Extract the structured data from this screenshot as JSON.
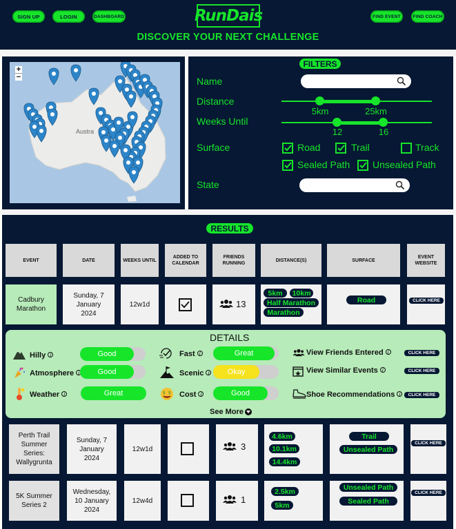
{
  "header": {
    "nav_left": [
      "SIGN UP",
      "LOGIN",
      "DASHBOARD"
    ],
    "logo": "RunDais",
    "nav_right": [
      "FIND EVENT",
      "FIND COACH"
    ],
    "tagline": "DISCOVER YOUR NEXT CHALLENGE"
  },
  "map": {
    "zoom_in": "+",
    "zoom_out": "−",
    "label": "Austra"
  },
  "filters": {
    "title": "FILTERS",
    "name_label": "Name",
    "distance_label": "Distance",
    "distance_min": "5km",
    "distance_max": "25km",
    "weeks_label": "Weeks Until",
    "weeks_min": "12",
    "weeks_max": "16",
    "surface_label": "Surface",
    "surfaces": [
      {
        "label": "Road",
        "checked": true
      },
      {
        "label": "Trail",
        "checked": true
      },
      {
        "label": "Track",
        "checked": false
      },
      {
        "label": "Sealed Path",
        "checked": true
      },
      {
        "label": "Unsealed Path",
        "checked": true
      }
    ],
    "state_label": "State"
  },
  "results": {
    "title": "RESULTS",
    "columns": [
      "EVENT",
      "DATE",
      "WEEKS UNTIL",
      "ADDED TO CALENDAR",
      "FRIENDS RUNNING",
      "DISTANCE(S)",
      "SURFACE",
      "EVENT WEBSITE"
    ],
    "rows": [
      {
        "event": "Cadbury Marathon",
        "date": "Sunday, 7 January 2024",
        "weeks": "12w1d",
        "added": true,
        "friends": "13",
        "distances": [
          "5km",
          "10km",
          "Half Marathon",
          "Marathon"
        ],
        "surfaces": [
          "Road"
        ],
        "website": "CLICK HERE"
      },
      {
        "event": "Perth Trail Summer Series: Wallygrunta",
        "date": "Sunday, 7 January 2024",
        "weeks": "12w1d",
        "added": false,
        "friends": "3",
        "distances": [
          "4.6km",
          "10.1km",
          "14.4km"
        ],
        "surfaces": [
          "Trail",
          "Unsealed Path"
        ],
        "website": "CLICK HERE"
      },
      {
        "event": "5K Summer Series 2",
        "date": "Wednesday, 10 January 2024",
        "weeks": "12w4d",
        "added": false,
        "friends": "1",
        "distances": [
          "2.5km",
          "5km"
        ],
        "surfaces": [
          "Unsealed Path",
          "Sealed Path"
        ],
        "website": "CLICK HERE"
      }
    ]
  },
  "details": {
    "title": "DETAILS",
    "ratings": [
      {
        "label": "Hilly",
        "value": "Good",
        "level": 0.82,
        "icon": "mountain-icon"
      },
      {
        "label": "Atmosphere",
        "value": "Good",
        "level": 0.82,
        "icon": "party-popper-icon"
      },
      {
        "label": "Weather",
        "value": "Great",
        "level": 1.0,
        "icon": "thermometer-icon"
      },
      {
        "label": "Fast",
        "value": "Great",
        "level": 0.82,
        "icon": "speed-check-icon"
      },
      {
        "label": "Scenic",
        "value": "Okay",
        "level": 0.7,
        "icon": "summit-flag-icon"
      },
      {
        "label": "Cost",
        "value": "Good",
        "level": 0.82,
        "icon": "money-face-icon"
      }
    ],
    "links": [
      {
        "label": "View Friends Entered",
        "action": "CLICK HERE",
        "icon": "people-icon"
      },
      {
        "label": "View Similar Events",
        "action": "CLICK HERE",
        "icon": "calendar-star-icon"
      },
      {
        "label": "Shoe Recommendations",
        "action": "CLICK HERE",
        "icon": "shoe-icon"
      }
    ],
    "see_more": "See More"
  },
  "colors": {
    "navy": "#061833",
    "green": "#16e52a",
    "light_green": "#b7ebb9",
    "yellow": "#f6e21d"
  }
}
